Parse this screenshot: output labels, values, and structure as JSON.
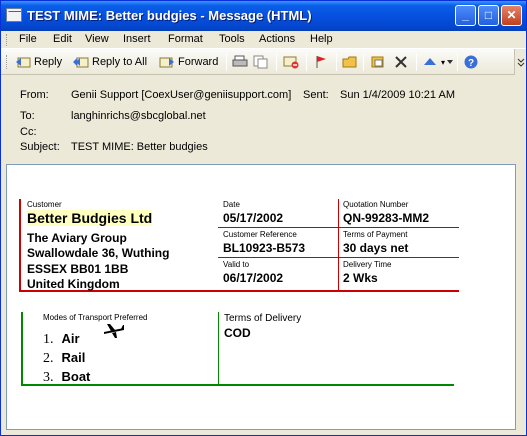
{
  "window": {
    "title": "TEST MIME: Better budgies - Message (HTML)",
    "controls": {
      "minimize": "_",
      "maximize": "□",
      "close": "✕"
    }
  },
  "menu": [
    "File",
    "Edit",
    "View",
    "Insert",
    "Format",
    "Tools",
    "Actions",
    "Help"
  ],
  "toolbar": {
    "reply": "Reply",
    "reply_all": "Reply to All",
    "forward": "Forward"
  },
  "header": {
    "from_label": "From:",
    "from_value": "Genii Support [CoexUser@geniisupport.com]",
    "sent_label": "Sent:",
    "sent_value": "Sun 1/4/2009 10:21 AM",
    "to_label": "To:",
    "to_value": "langhinrichs@sbcglobal.net",
    "cc_label": "Cc:",
    "subject_label": "Subject:",
    "subject_value": "TEST MIME: Better budgies"
  },
  "quote": {
    "customer_label": "Customer",
    "customer_name": "Better Budgies Ltd",
    "address": [
      "The Aviary Group",
      "Swallowdale 36, Wuthing",
      "ESSEX BB01 1BB",
      "United Kingdom"
    ],
    "date_label": "Date",
    "date_value": "05/17/2002",
    "customer_ref_label": "Customer Reference",
    "customer_ref_value": "BL10923-B573",
    "valid_to_label": "Valid to",
    "valid_to_value": "06/17/2002",
    "quote_no_label": "Quotation Number",
    "quote_no_value": "QN-99283-MM2",
    "payment_label": "Terms of Payment",
    "payment_value": "30 days net",
    "delivery_time_label": "Delivery Time",
    "delivery_time_value": "2 Wks",
    "transport_label": "Modes of Transport Preferred",
    "transport": [
      {
        "num": "1.",
        "mode": "Air"
      },
      {
        "num": "2.",
        "mode": "Rail"
      },
      {
        "num": "3.",
        "mode": "Boat"
      }
    ],
    "delivery_terms_label": "Terms of Delivery",
    "delivery_terms_value": "COD"
  },
  "colors": {
    "red": "#cc0000",
    "green": "#008800",
    "highlight": "#ffffc0"
  }
}
